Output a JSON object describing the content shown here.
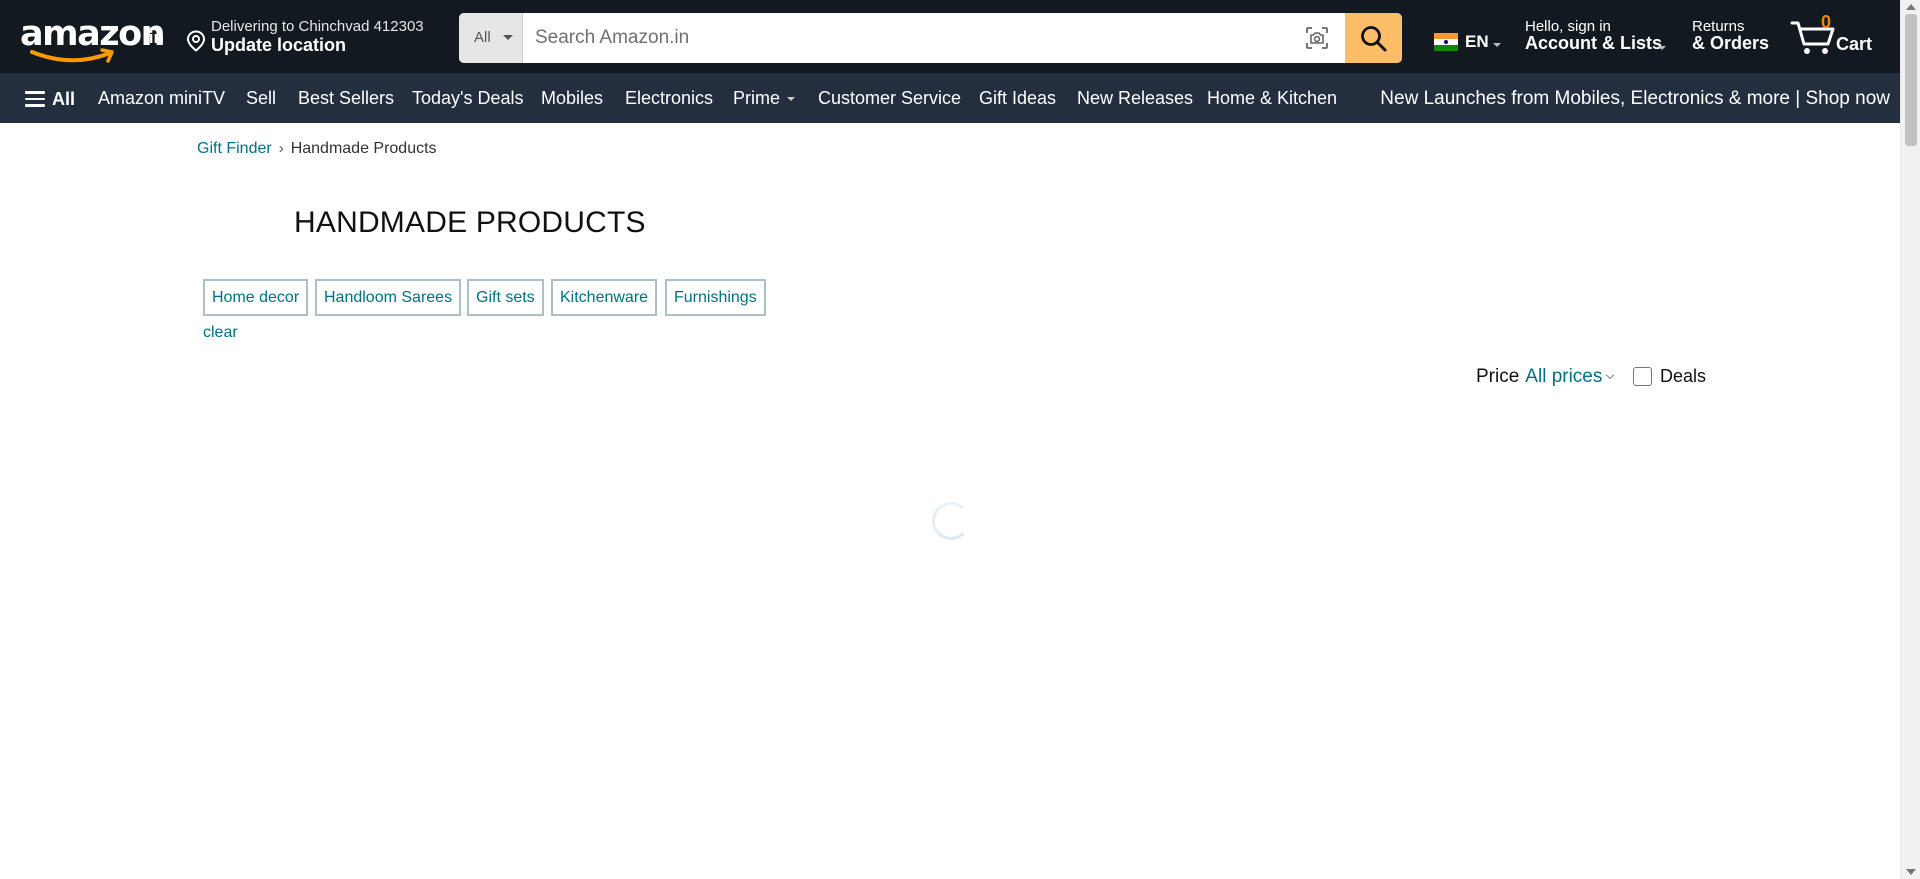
{
  "header": {
    "logo_text": "amazon",
    "logo_suffix": ".in",
    "delivery_line1": "Delivering to Chinchvad 412303",
    "delivery_line2": "Update location",
    "search_category": "All",
    "search_placeholder": "Search Amazon.in",
    "language": "EN",
    "account_line1": "Hello, sign in",
    "account_line2": "Account & Lists",
    "returns_line1": "Returns",
    "returns_line2": "& Orders",
    "cart_count": "0",
    "cart_label": "Cart"
  },
  "subnav": {
    "all_label": "All",
    "links": [
      "Amazon miniTV",
      "Sell",
      "Best Sellers",
      "Today's Deals",
      "Mobiles",
      "Electronics",
      "Prime",
      "Customer Service",
      "Gift Ideas",
      "New Releases",
      "Home & Kitchen"
    ],
    "promo": "New Launches from Mobiles, Electronics & more | Shop now"
  },
  "breadcrumb": {
    "parent": "Gift Finder",
    "current": "Handmade Products"
  },
  "page": {
    "title": "HANDMADE PRODUCTS",
    "filter_chips": [
      "Home decor",
      "Handloom Sarees",
      "Gift sets",
      "Kitchenware",
      "Furnishings"
    ],
    "clear_label": "clear",
    "price_label": "Price",
    "price_value": "All prices",
    "deals_label": "Deals"
  },
  "colors": {
    "nav_dark": "#131921",
    "nav_sub": "#232f3e",
    "search_button": "#febd69",
    "link": "#007185",
    "cart_count": "#f08804"
  }
}
